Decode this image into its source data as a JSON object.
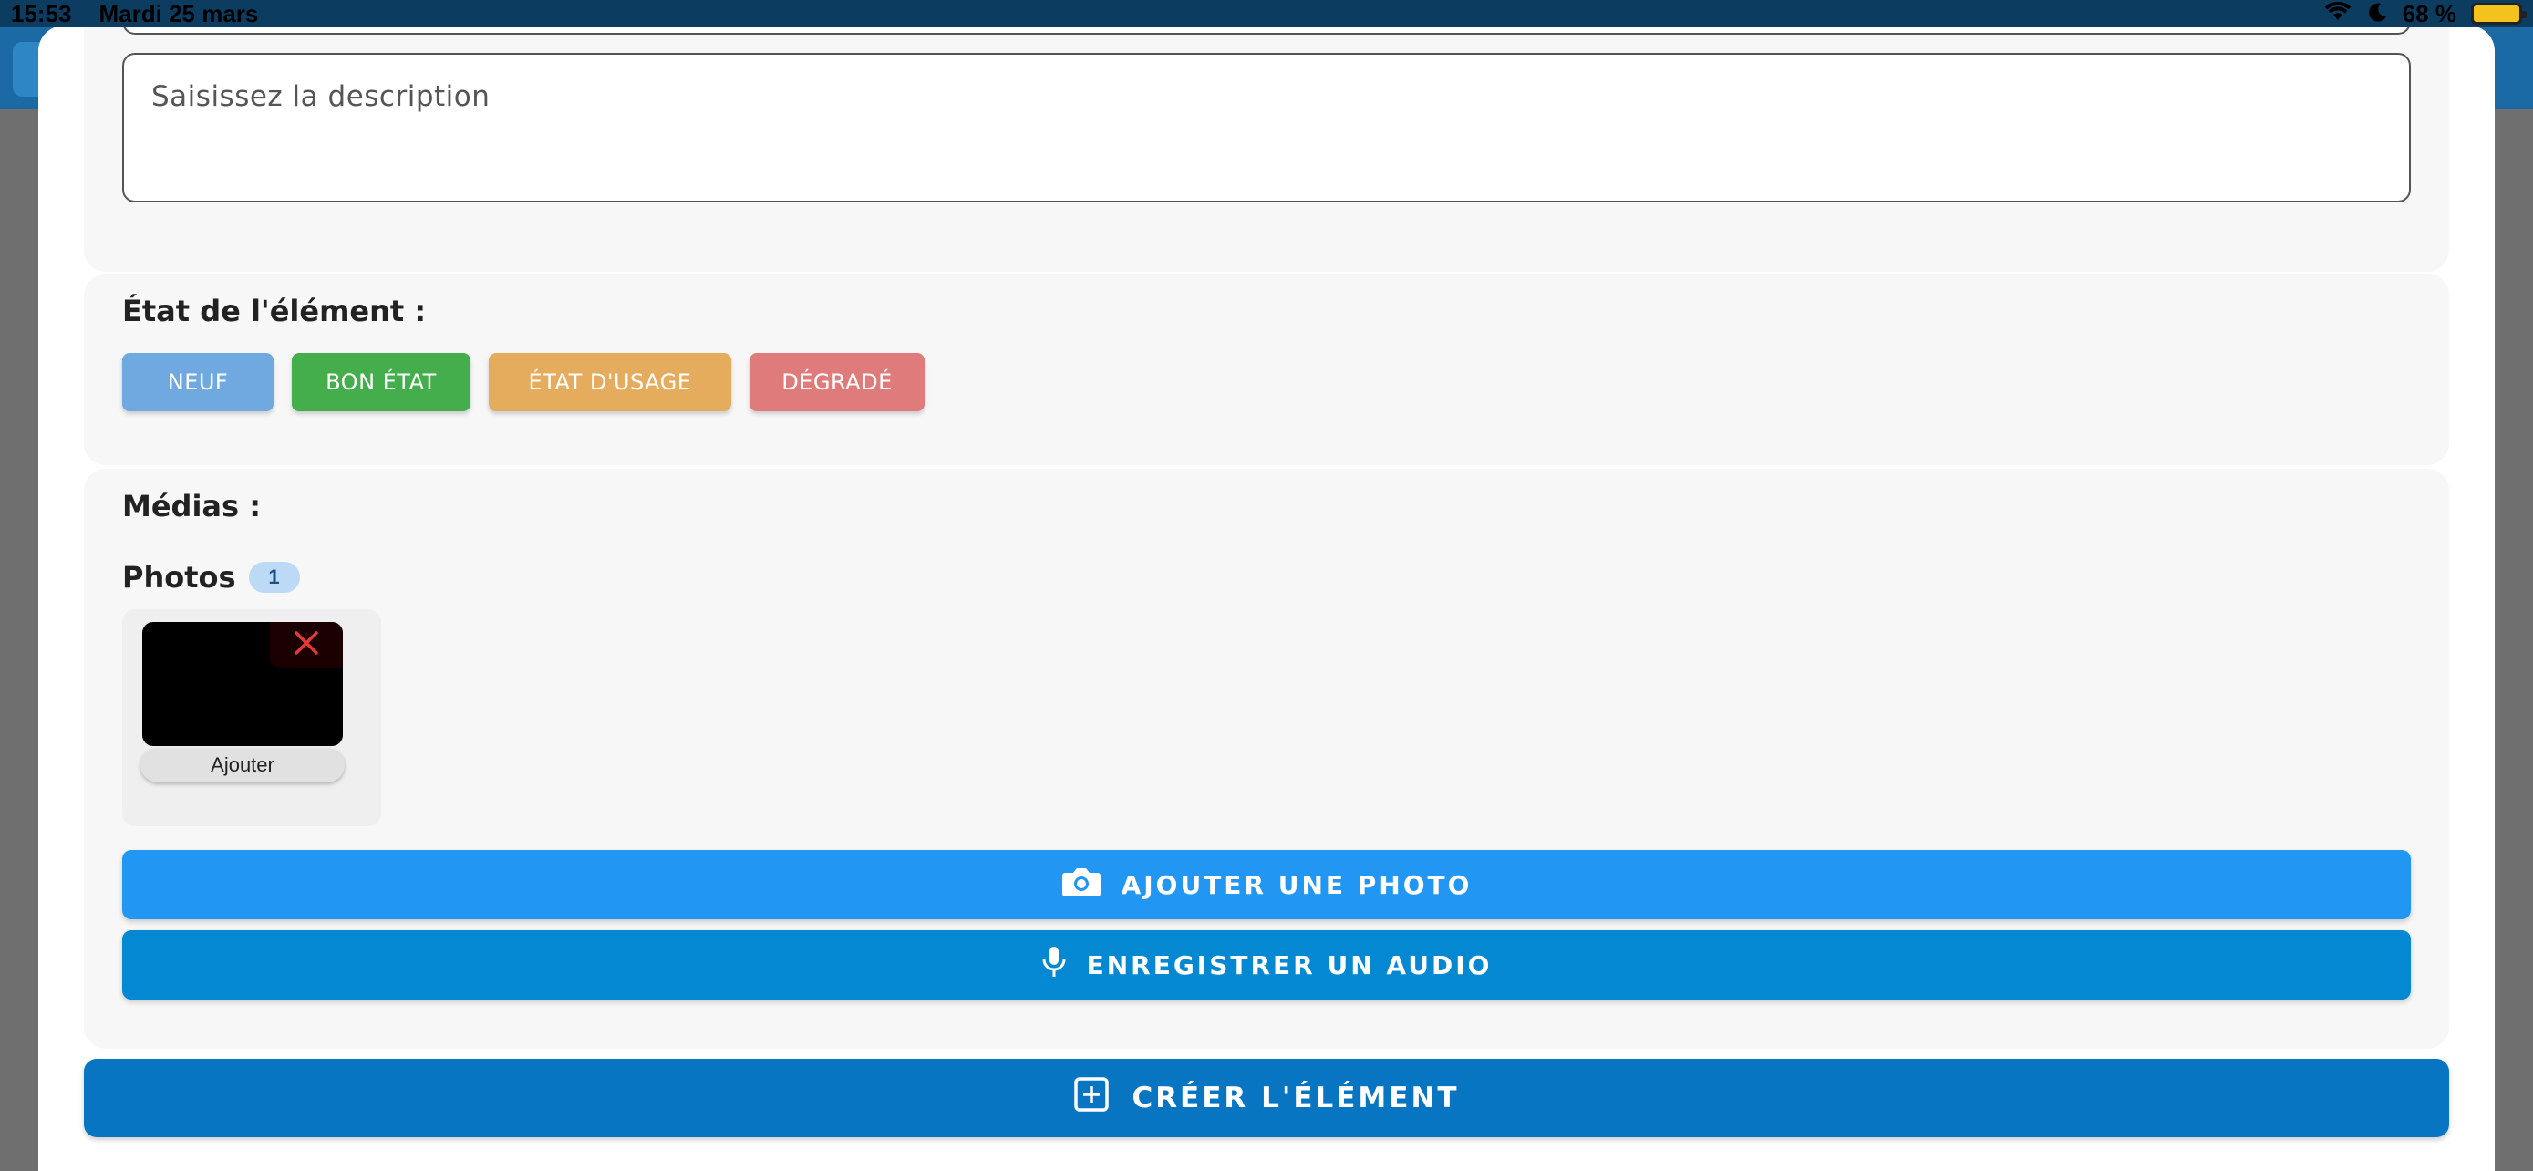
{
  "status_bar": {
    "time": "15:53",
    "date": "Mardi 25 mars",
    "battery": "68 %"
  },
  "description": {
    "placeholder": "Saisissez la description"
  },
  "state": {
    "label": "État de l'élément :",
    "options": [
      "NEUF",
      "BON ÉTAT",
      "ÉTAT D'USAGE",
      "DÉGRADÉ"
    ],
    "colors": [
      "#6fa9e0",
      "#43ae4b",
      "#e6ac5e",
      "#e07b7b"
    ]
  },
  "media": {
    "label": "Médias :",
    "photos_title": "Photos",
    "photos_count": "1",
    "thumb_button": "Ajouter",
    "add_photo": "AJOUTER UNE PHOTO",
    "record_audio": "ENREGISTRER UN AUDIO"
  },
  "create_button": "CRÉER L'ÉLÉMENT",
  "colors": {
    "primary": "#2196f3",
    "primary_dark": "#0775c2",
    "audio": "#0488d1"
  }
}
